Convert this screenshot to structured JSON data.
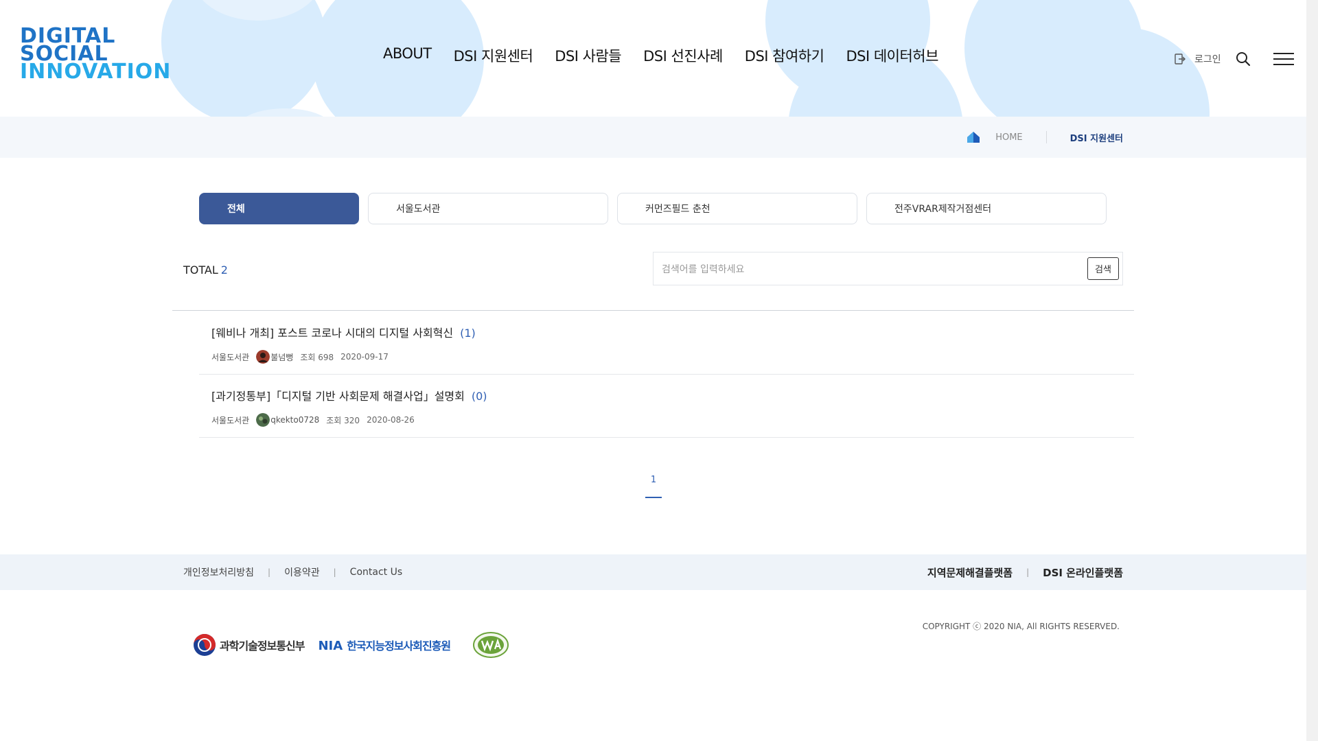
{
  "header": {
    "logo": {
      "lines": [
        "DIGITAL",
        "SOCIAL",
        "INNOVATION"
      ]
    },
    "nav": [
      "ABOUT",
      "DSI 지원센터",
      "DSI 사람들",
      "DSI 선진사례",
      "DSI 참여하기",
      "DSI 데이터허브"
    ],
    "login_label": "로그인"
  },
  "breadcrumb": {
    "home": "HOME",
    "current": "DSI 지원센터"
  },
  "tabs": [
    {
      "label": "전체",
      "active": true
    },
    {
      "label": "서울도서관",
      "active": false
    },
    {
      "label": "커먼즈필드 춘천",
      "active": false
    },
    {
      "label": "전주VRAR제작거점센터",
      "active": false
    }
  ],
  "summary": {
    "total_label": "TOTAL",
    "total_count": "2"
  },
  "search": {
    "placeholder": "검색어를 입력하세요",
    "value": "",
    "button": "검색"
  },
  "posts": [
    {
      "title": "[웨비나 개최] 포스트 코로나 시대의 디지털 사회혁신",
      "comments": "(1)",
      "org": "서울도서관",
      "author": "불넘뻥",
      "views": "조회 698",
      "date": "2020-09-17"
    },
    {
      "title": "[과기정통부]「디지털 기반 사회문제 해결사업」설명회",
      "comments": "(0)",
      "org": "서울도서관",
      "author": "qkekto0728",
      "views": "조회 320",
      "date": "2020-08-26"
    }
  ],
  "pagination": {
    "current": "1"
  },
  "footer": {
    "links": [
      "개인정보처리방침",
      "이용약관",
      "Contact Us"
    ],
    "platforms": [
      "지역문제해결플랫폼",
      "DSI 온라인플랫폼"
    ],
    "copyright": "COPYRIGHT ⓒ 2020 NIA, All RIGHTS RESERVED.",
    "logo_msit": "과학기술정보통신부",
    "logo_nia_abbr": "NIA",
    "logo_nia_name": "한국지능정보사회진흥원"
  },
  "colors": {
    "accent": "#3b5998",
    "link_blue": "#2f5fb3",
    "bubble": "#d8ecfd",
    "breadcrumb_bg": "#f4f7fb",
    "footer_bg": "#eef3f9"
  }
}
